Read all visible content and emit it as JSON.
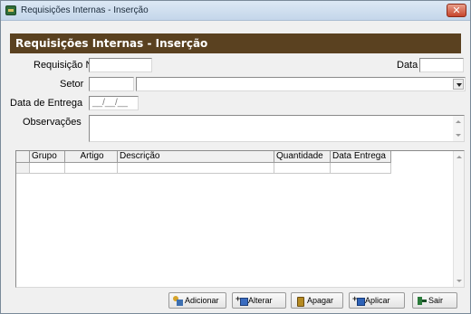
{
  "window": {
    "title": "Requisições Internas - Inserção",
    "close_glyph": "✕",
    "icon": "app-icon"
  },
  "header": {
    "banner": "Requisições Internas - Inserção",
    "banner_color": "#5a4120"
  },
  "form": {
    "requisicao_label": "Requisição Nº",
    "requisicao_value": "",
    "data_label": "Data",
    "data_value": "",
    "setor_label": "Setor",
    "setor_code_value": "",
    "setor_name_value": "",
    "data_entrega_label": "Data de Entrega",
    "data_entrega_value": "__/__/__",
    "observacoes_label": "Observações",
    "observacoes_value": ""
  },
  "grid": {
    "columns": [
      "",
      "Grupo",
      "Artigo",
      "Descrição",
      "Quantidade",
      "Data Entrega"
    ],
    "rows": []
  },
  "buttons": {
    "adicionar": "Adicionar",
    "alterar": "Alterar",
    "apagar": "Apagar",
    "aplicar": "Aplicar",
    "sair": "Sair"
  }
}
